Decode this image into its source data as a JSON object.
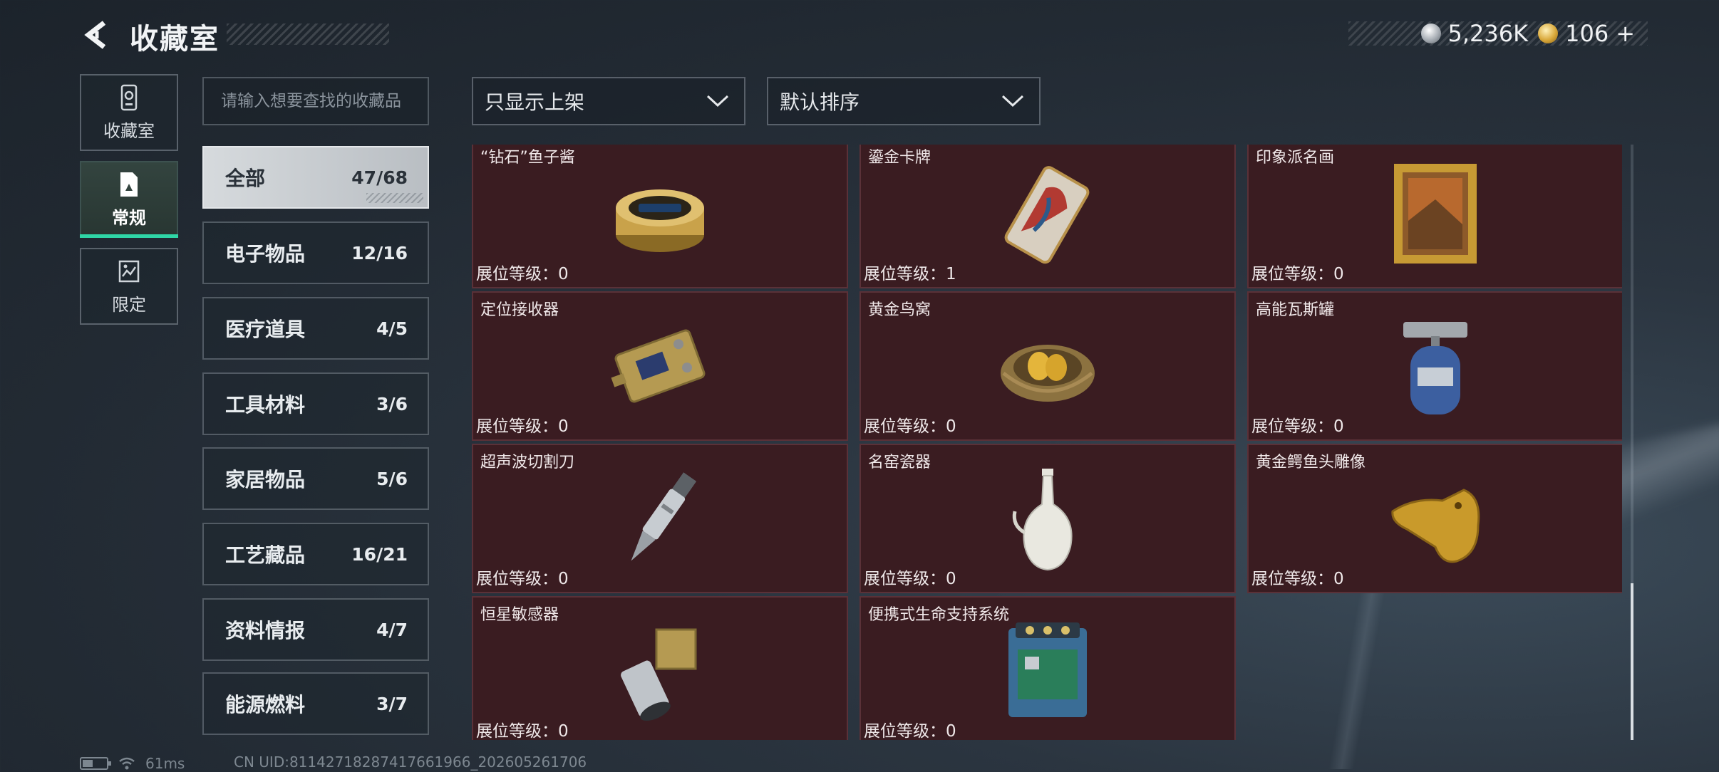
{
  "header": {
    "title": "收藏室",
    "currency": [
      {
        "icon": "silver-coin-icon",
        "value": "5,236K"
      },
      {
        "icon": "gold-coin-icon",
        "value": "106"
      }
    ],
    "add_label": "+"
  },
  "side_tabs": [
    {
      "label": "收藏室",
      "icon": "cabinet-icon",
      "active": false
    },
    {
      "label": "常规",
      "icon": "regular-collection-icon",
      "active": true
    },
    {
      "label": "限定",
      "icon": "limited-collection-icon",
      "active": false
    }
  ],
  "search": {
    "placeholder": "请输入想要查找的收藏品",
    "value": ""
  },
  "filters": {
    "display_filter": "只显示上架",
    "sort_order": "默认排序"
  },
  "categories": [
    {
      "name": "全部",
      "count": "47/68",
      "active": true
    },
    {
      "name": "电子物品",
      "count": "12/16"
    },
    {
      "name": "医疗道具",
      "count": "4/5"
    },
    {
      "name": "工具材料",
      "count": "3/6"
    },
    {
      "name": "家居物品",
      "count": "5/6"
    },
    {
      "name": "工艺藏品",
      "count": "16/21"
    },
    {
      "name": "资料情报",
      "count": "4/7"
    },
    {
      "name": "能源燃料",
      "count": "3/7"
    }
  ],
  "items": [
    {
      "name": "“钻石”鱼子酱",
      "level": "展位等级：0",
      "icon": "caviar-tin-icon"
    },
    {
      "name": "鎏金卡牌",
      "level": "展位等级：1",
      "icon": "gilded-card-icon"
    },
    {
      "name": "印象派名画",
      "level": "展位等级：0",
      "icon": "framed-painting-icon"
    },
    {
      "name": "定位接收器",
      "level": "展位等级：0",
      "icon": "gps-receiver-icon"
    },
    {
      "name": "黄金鸟窝",
      "level": "展位等级：0",
      "icon": "golden-nest-icon"
    },
    {
      "name": "高能瓦斯罐",
      "level": "展位等级：0",
      "icon": "gas-canister-icon"
    },
    {
      "name": "超声波切割刀",
      "level": "展位等级：0",
      "icon": "ultrasonic-cutter-icon"
    },
    {
      "name": "名窑瓷器",
      "level": "展位等级：0",
      "icon": "porcelain-vase-icon"
    },
    {
      "name": "黄金鳄鱼头雕像",
      "level": "展位等级：0",
      "icon": "golden-crocodile-head-icon"
    },
    {
      "name": "恒星敏感器",
      "level": "展位等级：0",
      "icon": "star-sensor-icon"
    },
    {
      "name": "便携式生命支持系统",
      "level": "展位等级：0",
      "icon": "life-support-system-icon"
    }
  ],
  "status_bar": {
    "ping": "61ms",
    "uid": "CN UID:81142718287417661966_202605261706"
  }
}
